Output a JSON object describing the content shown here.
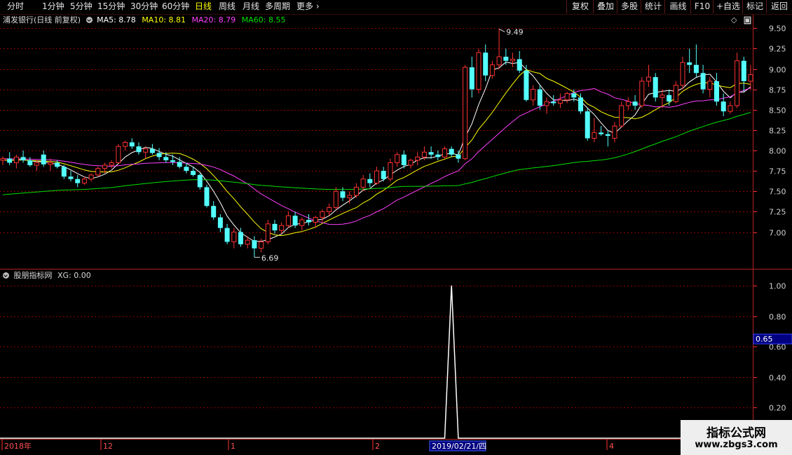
{
  "toolbar": {
    "periods": [
      "分时",
      "1分钟",
      "5分钟",
      "15分钟",
      "30分钟",
      "60分钟",
      "日线",
      "周线",
      "月线",
      "多周期"
    ],
    "active_period": "日线",
    "more": "更多",
    "buttons": [
      "复权",
      "叠加",
      "多股",
      "统计",
      "画线",
      "F10",
      "+自选",
      "标记",
      "返回"
    ]
  },
  "main_panel": {
    "title": "浦发银行(日线 前复权)",
    "ma": [
      {
        "label": "MA5: 8.78",
        "color": "#ffffff"
      },
      {
        "label": "MA10: 8.81",
        "color": "#ffff00"
      },
      {
        "label": "MA20: 8.79",
        "color": "#ff40ff"
      },
      {
        "label": "MA60: 8.55",
        "color": "#00e000"
      }
    ],
    "high_marker": "9.49",
    "low_marker": "6.69"
  },
  "indicator_panel": {
    "title": "股朋指标网",
    "value_label": "XG: 0.00",
    "current_value_box": "0.65"
  },
  "time_axis": {
    "labels": [
      "2018年",
      "12",
      "1",
      "2",
      "4"
    ],
    "cursor_date": "2019/02/21/四"
  },
  "watermark": {
    "line1": "指标公式网",
    "line2": "www.zbgs3.com"
  },
  "colors": {
    "up": "#ff3232",
    "down": "#54ffff",
    "ma5": "#ffffff",
    "ma10": "#ffff00",
    "ma20": "#ff40ff",
    "ma60": "#00e000",
    "grid": "#8b0000",
    "axis": "#ff3232"
  },
  "chart_data": [
    {
      "type": "candlestick",
      "title": "浦发银行(日线 前复权)",
      "y_ticks": [
        7.0,
        7.25,
        7.5,
        7.75,
        8.0,
        8.25,
        8.5,
        8.75,
        9.0,
        9.25,
        9.5
      ],
      "ylim": [
        6.55,
        9.62
      ],
      "annotations": [
        {
          "text": "9.49",
          "value": 9.49
        },
        {
          "text": "6.69",
          "value": 6.69
        }
      ],
      "candles": [
        [
          7.88,
          7.93,
          7.82,
          7.9
        ],
        [
          7.9,
          7.98,
          7.82,
          7.85
        ],
        [
          7.85,
          7.95,
          7.78,
          7.92
        ],
        [
          7.92,
          8.0,
          7.85,
          7.88
        ],
        [
          7.88,
          7.92,
          7.8,
          7.82
        ],
        [
          7.82,
          7.88,
          7.75,
          7.85
        ],
        [
          7.95,
          8.0,
          7.8,
          7.83
        ],
        [
          7.83,
          7.9,
          7.75,
          7.85
        ],
        [
          7.85,
          7.88,
          7.78,
          7.8
        ],
        [
          7.8,
          7.82,
          7.65,
          7.68
        ],
        [
          7.68,
          7.75,
          7.62,
          7.65
        ],
        [
          7.65,
          7.7,
          7.55,
          7.6
        ],
        [
          7.6,
          7.68,
          7.58,
          7.65
        ],
        [
          7.65,
          7.72,
          7.62,
          7.7
        ],
        [
          7.7,
          7.8,
          7.68,
          7.78
        ],
        [
          7.78,
          7.85,
          7.72,
          7.82
        ],
        [
          7.82,
          7.88,
          7.78,
          7.85
        ],
        [
          7.85,
          8.08,
          7.84,
          8.05
        ],
        [
          8.05,
          8.12,
          8.0,
          8.1
        ],
        [
          8.1,
          8.15,
          8.02,
          8.05
        ],
        [
          8.05,
          8.1,
          7.95,
          7.98
        ],
        [
          7.98,
          8.05,
          7.9,
          8.02
        ],
        [
          8.02,
          8.08,
          7.95,
          7.97
        ],
        [
          7.97,
          8.03,
          7.88,
          7.92
        ],
        [
          7.92,
          7.98,
          7.85,
          7.88
        ],
        [
          7.88,
          7.95,
          7.82,
          7.86
        ],
        [
          7.86,
          7.92,
          7.78,
          7.8
        ],
        [
          7.8,
          7.85,
          7.72,
          7.75
        ],
        [
          7.75,
          7.8,
          7.68,
          7.7
        ],
        [
          7.7,
          7.72,
          7.52,
          7.55
        ],
        [
          7.55,
          7.58,
          7.3,
          7.32
        ],
        [
          7.32,
          7.38,
          7.15,
          7.18
        ],
        [
          7.18,
          7.22,
          7.0,
          7.05
        ],
        [
          7.05,
          7.1,
          6.85,
          6.88
        ],
        [
          6.88,
          7.05,
          6.8,
          7.0
        ],
        [
          7.0,
          7.05,
          6.82,
          6.85
        ],
        [
          6.85,
          6.95,
          6.8,
          6.9
        ],
        [
          6.9,
          6.95,
          6.69,
          6.8
        ],
        [
          6.8,
          6.92,
          6.75,
          6.88
        ],
        [
          6.88,
          7.15,
          6.85,
          7.1
        ],
        [
          7.1,
          7.15,
          6.98,
          7.02
        ],
        [
          7.02,
          7.12,
          6.98,
          7.08
        ],
        [
          7.08,
          7.25,
          7.05,
          7.2
        ],
        [
          7.2,
          7.25,
          7.05,
          7.08
        ],
        [
          7.08,
          7.18,
          7.02,
          7.15
        ],
        [
          7.15,
          7.22,
          7.08,
          7.12
        ],
        [
          7.12,
          7.2,
          7.05,
          7.18
        ],
        [
          7.18,
          7.28,
          7.12,
          7.25
        ],
        [
          7.25,
          7.35,
          7.2,
          7.3
        ],
        [
          7.3,
          7.55,
          7.28,
          7.5
        ],
        [
          7.5,
          7.55,
          7.38,
          7.42
        ],
        [
          7.42,
          7.5,
          7.35,
          7.45
        ],
        [
          7.45,
          7.6,
          7.42,
          7.55
        ],
        [
          7.55,
          7.7,
          7.5,
          7.65
        ],
        [
          7.65,
          7.72,
          7.55,
          7.6
        ],
        [
          7.6,
          7.8,
          7.58,
          7.75
        ],
        [
          7.75,
          7.8,
          7.62,
          7.65
        ],
        [
          7.65,
          7.9,
          7.62,
          7.85
        ],
        [
          7.85,
          7.98,
          7.8,
          7.95
        ],
        [
          7.95,
          8.0,
          7.78,
          7.82
        ],
        [
          7.82,
          7.9,
          7.78,
          7.88
        ],
        [
          7.88,
          7.98,
          7.82,
          7.92
        ],
        [
          7.92,
          8.05,
          7.88,
          7.98
        ],
        [
          7.98,
          8.05,
          7.9,
          7.95
        ],
        [
          7.95,
          8.0,
          7.88,
          7.92
        ],
        [
          7.92,
          8.05,
          7.9,
          8.02
        ],
        [
          8.02,
          8.05,
          7.92,
          7.95
        ],
        [
          7.95,
          8.0,
          7.85,
          7.9
        ],
        [
          7.9,
          9.05,
          7.88,
          9.02
        ],
        [
          9.02,
          9.15,
          8.65,
          8.75
        ],
        [
          8.75,
          9.25,
          8.7,
          9.2
        ],
        [
          9.2,
          9.3,
          8.85,
          8.92
        ],
        [
          8.92,
          9.1,
          8.88,
          9.05
        ],
        [
          9.05,
          9.49,
          9.0,
          9.15
        ],
        [
          9.15,
          9.25,
          9.05,
          9.1
        ],
        [
          9.1,
          9.2,
          9.02,
          9.12
        ],
        [
          9.12,
          9.22,
          8.95,
          8.98
        ],
        [
          8.98,
          9.05,
          8.6,
          8.62
        ],
        [
          8.62,
          8.8,
          8.55,
          8.75
        ],
        [
          8.75,
          8.8,
          8.5,
          8.55
        ],
        [
          8.55,
          8.65,
          8.45,
          8.6
        ],
        [
          8.6,
          8.68,
          8.55,
          8.58
        ],
        [
          8.58,
          8.7,
          8.52,
          8.62
        ],
        [
          8.62,
          8.72,
          8.58,
          8.7
        ],
        [
          8.7,
          8.75,
          8.6,
          8.65
        ],
        [
          8.65,
          8.7,
          8.45,
          8.48
        ],
        [
          8.48,
          8.52,
          8.12,
          8.15
        ],
        [
          8.15,
          8.4,
          8.1,
          8.22
        ],
        [
          8.22,
          8.3,
          8.18,
          8.2
        ],
        [
          8.2,
          8.25,
          8.05,
          8.18
        ],
        [
          8.15,
          8.35,
          8.1,
          8.3
        ],
        [
          8.3,
          8.6,
          8.28,
          8.55
        ],
        [
          8.55,
          8.65,
          8.5,
          8.6
        ],
        [
          8.6,
          8.68,
          8.5,
          8.55
        ],
        [
          8.55,
          8.9,
          8.52,
          8.85
        ],
        [
          8.85,
          9.05,
          8.78,
          8.9
        ],
        [
          8.9,
          8.95,
          8.6,
          8.65
        ],
        [
          8.65,
          8.75,
          8.52,
          8.68
        ],
        [
          8.68,
          8.75,
          8.55,
          8.6
        ],
        [
          8.6,
          8.85,
          8.58,
          8.8
        ],
        [
          8.8,
          9.15,
          8.75,
          9.08
        ],
        [
          9.08,
          9.25,
          8.95,
          9.05
        ],
        [
          9.05,
          9.3,
          8.9,
          8.95
        ],
        [
          8.95,
          9.05,
          8.7,
          8.75
        ],
        [
          8.75,
          8.9,
          8.65,
          8.85
        ],
        [
          8.85,
          8.95,
          8.55,
          8.6
        ],
        [
          8.6,
          8.7,
          8.42,
          8.48
        ],
        [
          8.48,
          8.6,
          8.45,
          8.55
        ],
        [
          8.55,
          9.2,
          8.52,
          9.1
        ],
        [
          9.1,
          9.15,
          8.72,
          8.85
        ],
        [
          8.85,
          9.05,
          8.75,
          8.93
        ]
      ]
    },
    {
      "type": "line",
      "title": "股朋指标网",
      "series": [
        {
          "name": "XG",
          "values": [
            0.0,
            1.0,
            0.0
          ],
          "x_index": [
            69,
            70,
            71
          ]
        }
      ],
      "x_count": 111,
      "y_ticks": [
        0.2,
        0.4,
        0.6,
        0.8,
        1.0
      ],
      "ylim": [
        0.0,
        1.05
      ]
    }
  ]
}
